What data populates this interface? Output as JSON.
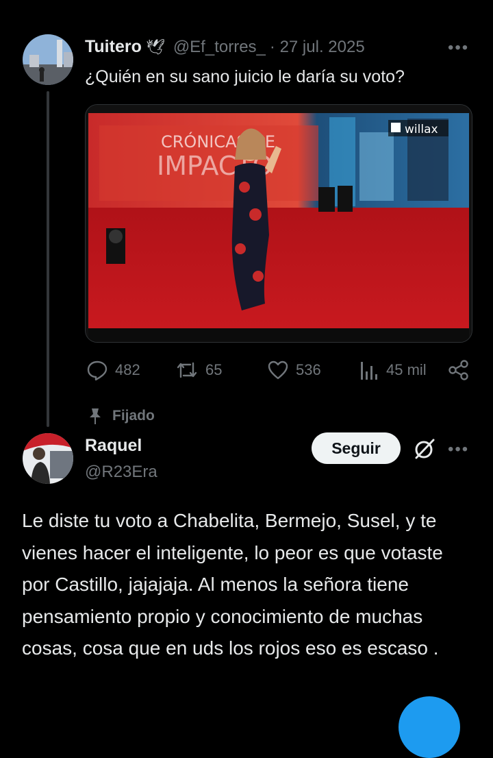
{
  "tweet": {
    "author_name": "Tuitero",
    "author_emoji": "🕊",
    "handle": "@Ef_torres_",
    "date": "· 27 jul. 2025",
    "text": "¿Quién en su sano juicio le daría su voto?",
    "media": {
      "overlay_title_line1": "CRÓNICAS DE",
      "overlay_title_line2": "IMPACTO",
      "channel_logo": "willax"
    },
    "stats": {
      "replies": "482",
      "reposts": "65",
      "likes": "536",
      "views": "45 mil"
    }
  },
  "pinned_label": "Fijado",
  "reply": {
    "author_name": "Raquel",
    "handle": "@R23Era",
    "follow_label": "Seguir",
    "text": "Le diste tu voto a Chabelita, Bermejo, Susel, y te vienes hacer el inteligente, lo peor es que votaste por Castillo, jajajaja. Al menos la señora tiene pensamiento propio y conocimiento de muchas cosas, cosa que en uds los rojos eso es escaso ."
  },
  "icons": [
    "more-icon",
    "reply-icon",
    "repost-icon",
    "like-icon",
    "views-icon",
    "share-icon",
    "pin-icon",
    "grok-icon",
    "compose-fab"
  ],
  "colors": {
    "background": "#000000",
    "text": "#e7e9ea",
    "muted": "#71767b",
    "accent": "#1d9bf0",
    "button_bg": "#eff3f4"
  }
}
